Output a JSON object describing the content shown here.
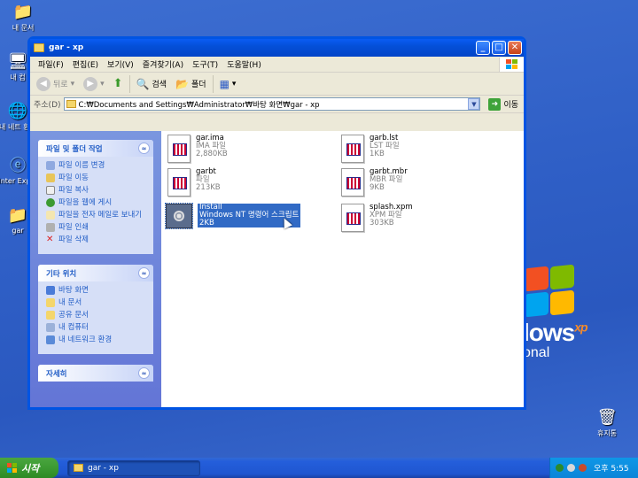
{
  "desktop": {
    "icons": [
      {
        "label": "내 문서",
        "glyph": "📁"
      },
      {
        "label": "내 컴",
        "glyph": "🖥"
      },
      {
        "label": "내 네트 환경",
        "glyph": "🌐"
      },
      {
        "label": "Inter Explo",
        "glyph": "ⓔ"
      },
      {
        "label": "gar",
        "glyph": "📁"
      },
      {
        "label": "휴지통",
        "glyph": "🗑"
      }
    ],
    "xp_logo": {
      "word": "lows",
      "sup": "xp",
      "sub": "onal"
    }
  },
  "window": {
    "title": "gar - xp",
    "buttons": {
      "minimize": "_",
      "maximize": "□",
      "close": "✕"
    },
    "menu": [
      "파일(F)",
      "편집(E)",
      "보기(V)",
      "즐겨찾기(A)",
      "도구(T)",
      "도움말(H)"
    ],
    "toolbar": {
      "back": "뒤로",
      "search": "검색",
      "folders": "폴더"
    },
    "address": {
      "label": "주소(D)",
      "value": "C:₩Documents and Settings₩Administrator₩바탕 화면₩gar - xp",
      "go": "이동"
    }
  },
  "taskpane": {
    "panels": [
      {
        "title": "파일 및 폴더 작업",
        "toggle": "≈",
        "items": [
          "파일 이름 변경",
          "파일 이동",
          "파일 복사",
          "파일을 웹에 게시",
          "파일을 전자 메일로 보내기",
          "파일 인쇄",
          "파일 삭제"
        ]
      },
      {
        "title": "기타 위치",
        "toggle": "≈",
        "items": [
          "바탕 화면",
          "내 문서",
          "공유 문서",
          "내 컴퓨터",
          "내 네트워크 환경"
        ]
      },
      {
        "title": "자세히",
        "toggle": "≈",
        "items": []
      }
    ]
  },
  "files": [
    {
      "name": "gar.ima",
      "type": "IMA 파일",
      "size": "2,880KB",
      "kind": "doc",
      "selected": false
    },
    {
      "name": "garb.lst",
      "type": "LST 파일",
      "size": "1KB",
      "kind": "doc",
      "selected": false
    },
    {
      "name": "garbt",
      "type": "파일",
      "size": "213KB",
      "kind": "doc",
      "selected": false
    },
    {
      "name": "garbt.mbr",
      "type": "MBR 파일",
      "size": "9KB",
      "kind": "doc",
      "selected": false
    },
    {
      "name": "Install",
      "type": "Windows NT 명령어 스크립트",
      "size": "2KB",
      "kind": "bat",
      "selected": true
    },
    {
      "name": "splash.xpm",
      "type": "XPM 파일",
      "size": "303KB",
      "kind": "doc",
      "selected": false
    }
  ],
  "taskbar": {
    "start": "시작",
    "active_task": "gar - xp",
    "clock": "오후 5:55"
  }
}
